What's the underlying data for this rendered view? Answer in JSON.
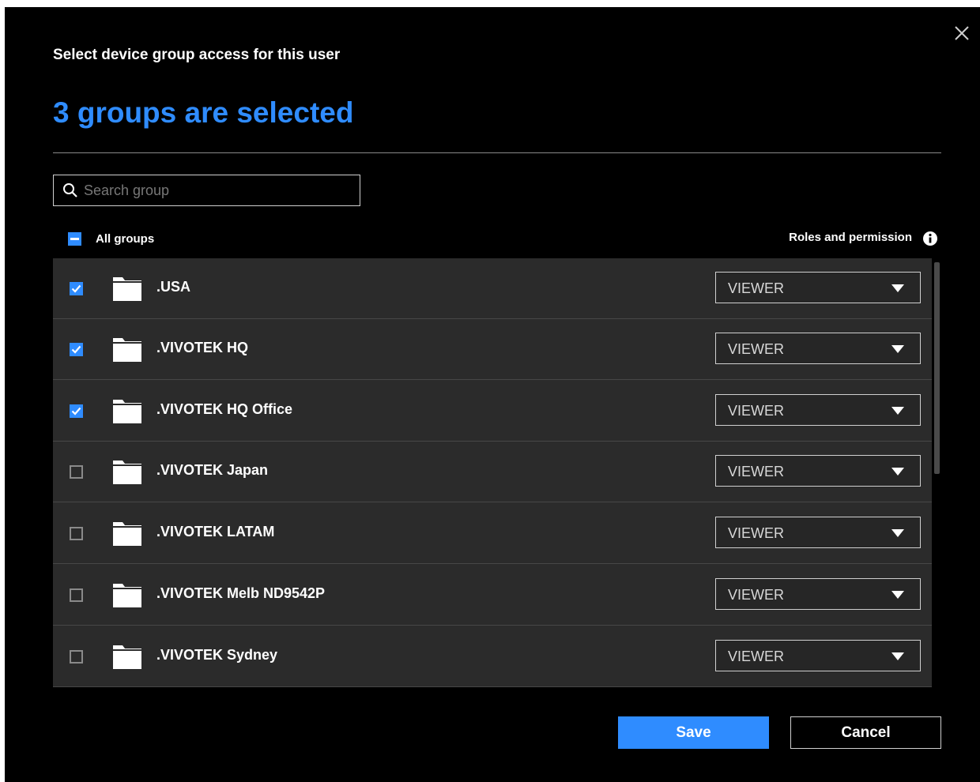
{
  "dialog": {
    "subtitle": "Select device group access for this user",
    "selected_count_text": "3 groups are selected",
    "close_icon": "close-icon"
  },
  "search": {
    "placeholder": "Search group",
    "value": "",
    "icon": "search-icon"
  },
  "header": {
    "all_groups_label": "All groups",
    "all_groups_state": "indeterminate",
    "roles_label": "Roles and permission",
    "info_icon": "info-icon"
  },
  "groups": [
    {
      "name": ".USA",
      "checked": true,
      "role": "VIEWER"
    },
    {
      "name": ".VIVOTEK HQ",
      "checked": true,
      "role": "VIEWER"
    },
    {
      "name": ".VIVOTEK HQ Office",
      "checked": true,
      "role": "VIEWER"
    },
    {
      "name": ".VIVOTEK Japan",
      "checked": false,
      "role": "VIEWER"
    },
    {
      "name": ".VIVOTEK LATAM",
      "checked": false,
      "role": "VIEWER"
    },
    {
      "name": ".VIVOTEK Melb ND9542P",
      "checked": false,
      "role": "VIEWER"
    },
    {
      "name": ".VIVOTEK Sydney",
      "checked": false,
      "role": "VIEWER"
    }
  ],
  "buttons": {
    "save_label": "Save",
    "cancel_label": "Cancel"
  },
  "colors": {
    "accent": "#2f8cff",
    "background": "#000000",
    "list_background": "#2b2b2b"
  }
}
